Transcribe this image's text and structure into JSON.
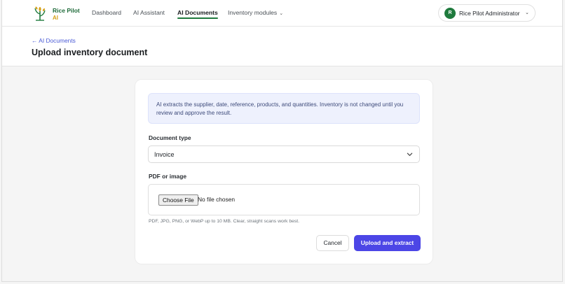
{
  "brand": {
    "line1": "Rice Pilot",
    "line2": "AI"
  },
  "nav": {
    "dashboard": "Dashboard",
    "ai_assistant": "AI Assistant",
    "ai_documents": "AI Documents",
    "inventory_modules": "Inventory modules"
  },
  "user": {
    "initial": "R",
    "name": "Rice Pilot Administrator"
  },
  "page": {
    "back_link": "← AI Documents",
    "title": "Upload inventory document"
  },
  "form": {
    "info_text": "AI extracts the supplier, date, reference, products, and quantities. Inventory is not changed until you review and approve the result.",
    "document_type_label": "Document type",
    "document_type_value": "Invoice",
    "file_label": "PDF or image",
    "choose_file_label": "Choose File",
    "no_file_text": "No file chosen",
    "hint": "PDF, JPG, PNG, or WebP up to 10 MB. Clear, straight scans work best.",
    "cancel_label": "Cancel",
    "submit_label": "Upload and extract"
  },
  "colors": {
    "brand_green": "#1f7a3d",
    "accent_gold": "#d4a017",
    "primary_button": "#4c46e6",
    "link": "#4b5bd6",
    "info_bg": "#eef1fd"
  }
}
